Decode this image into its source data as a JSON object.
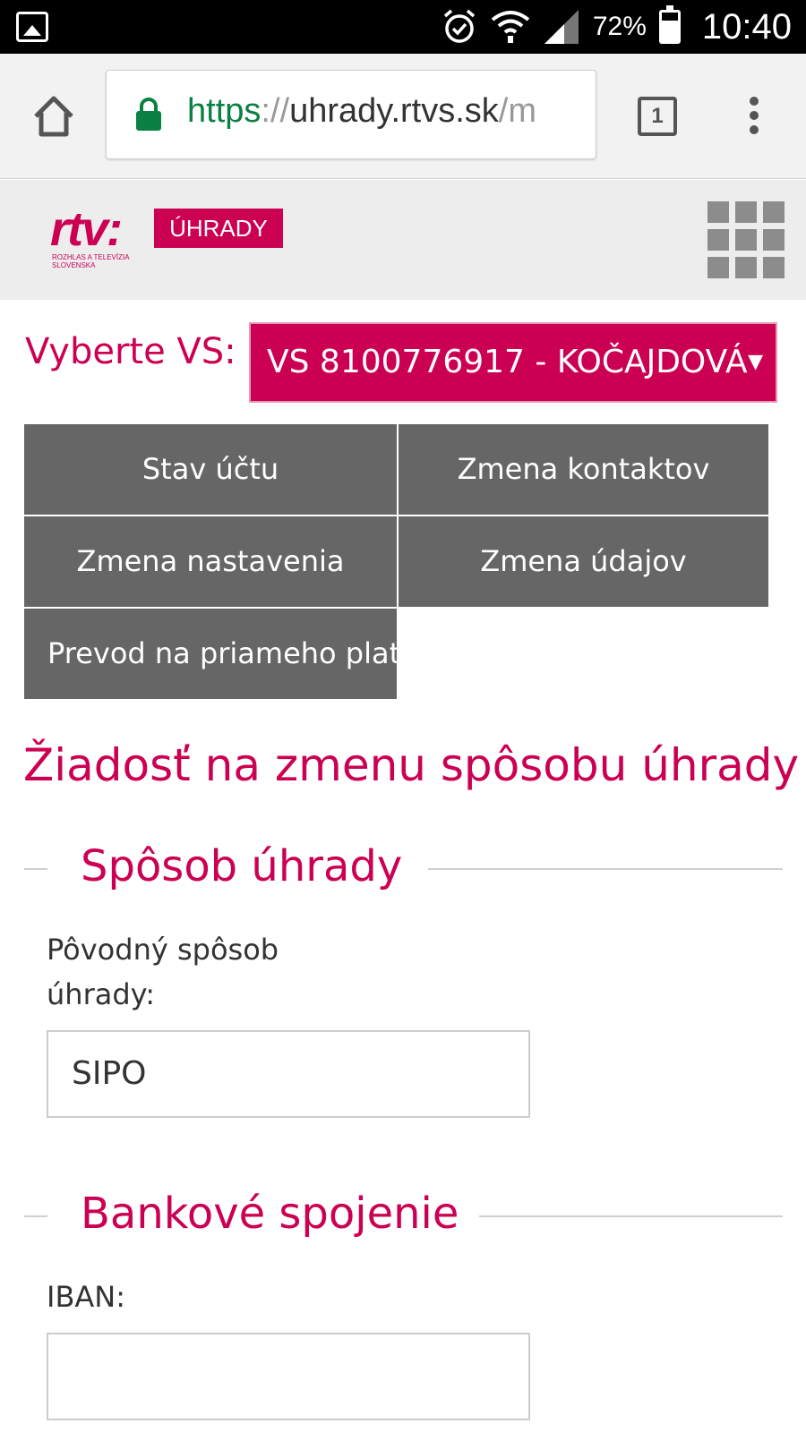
{
  "status_bar": {
    "battery_percent": "72%",
    "time": "10:40",
    "icons": [
      "gallery-icon",
      "alarm-icon",
      "wifi-icon",
      "signal-icon",
      "battery-icon"
    ]
  },
  "browser": {
    "url_scheme": "https",
    "url_separator": "://",
    "url_host": "uhrady.rtvs.sk",
    "url_path": "/m",
    "tab_count": "1"
  },
  "site": {
    "logo_text": "rtv:",
    "logo_subtext": "ROZHLAS A TELEVÍZIA SLOVENSKA",
    "logo_badge": "ÚHRADY"
  },
  "vs": {
    "label": "Vyberte VS:",
    "selected": "VS 8100776917 - KOČAJDOVÁ",
    "arrow": "▼"
  },
  "nav_tiles": [
    {
      "label": "Stav účtu"
    },
    {
      "label": "Zmena kontaktov"
    },
    {
      "label": "Zmena nastavenia"
    },
    {
      "label": "Zmena údajov"
    },
    {
      "label": "Prevod na priameho platiteľa"
    }
  ],
  "page_title": "Žiadosť na zmenu spôsobu úhrady",
  "sections": {
    "payment_method": {
      "legend": "Spôsob úhrady",
      "original_label_line1": "Pôvodný spôsob",
      "original_label_line2": "úhrady:",
      "original_value": "SIPO"
    },
    "bank": {
      "legend": "Bankové spojenie",
      "iban_label": "IBAN:",
      "iban_value": ""
    }
  },
  "colors": {
    "brand": "#cc0052",
    "tile": "#666666",
    "secure": "#0b8043"
  }
}
